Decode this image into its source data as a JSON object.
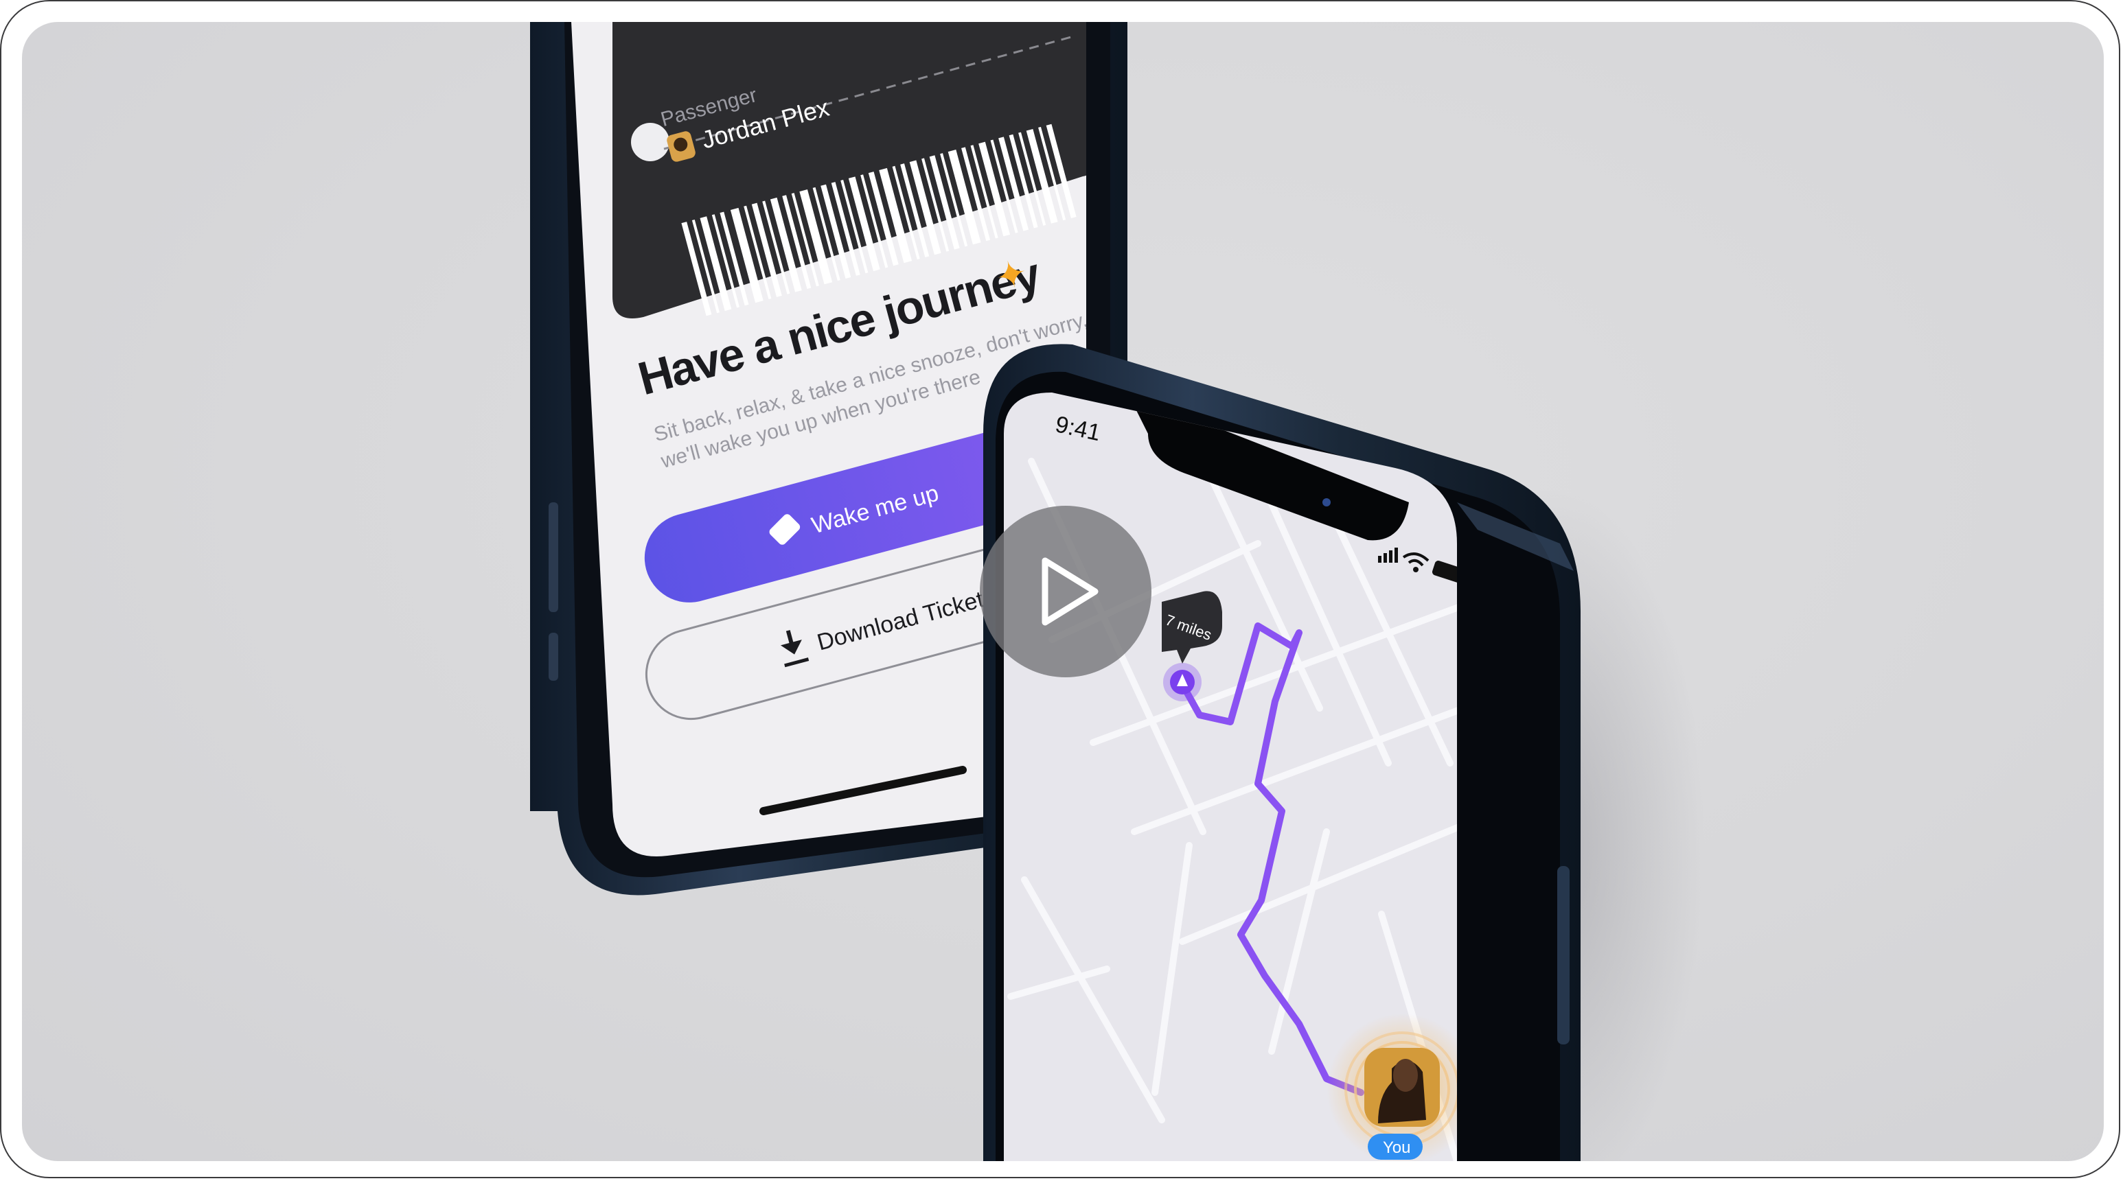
{
  "ticket": {
    "passenger_label": "Passenger",
    "passenger_name": "Jordan Plex"
  },
  "journey": {
    "headline": "Have a nice journey",
    "subtitle_line1": "Sit back, relax, & take a nice snooze, don't worry,",
    "subtitle_line2": "we'll wake you up when you're there",
    "wake_button_label": "Wake me up",
    "download_button_label": "Download Ticket"
  },
  "map_phone": {
    "status_time": "9:41",
    "distance_bubble": "7 miles",
    "you_badge": "You"
  },
  "colors": {
    "accent_start": "#5c53e6",
    "accent_end": "#8a5cf0",
    "route": "#8a52f2",
    "phone_frame": "#1c2a3d"
  },
  "icons": {
    "play": "play-icon",
    "download": "download-icon",
    "ticket": "ticket-icon",
    "sparkle": "sparkle-icon"
  }
}
